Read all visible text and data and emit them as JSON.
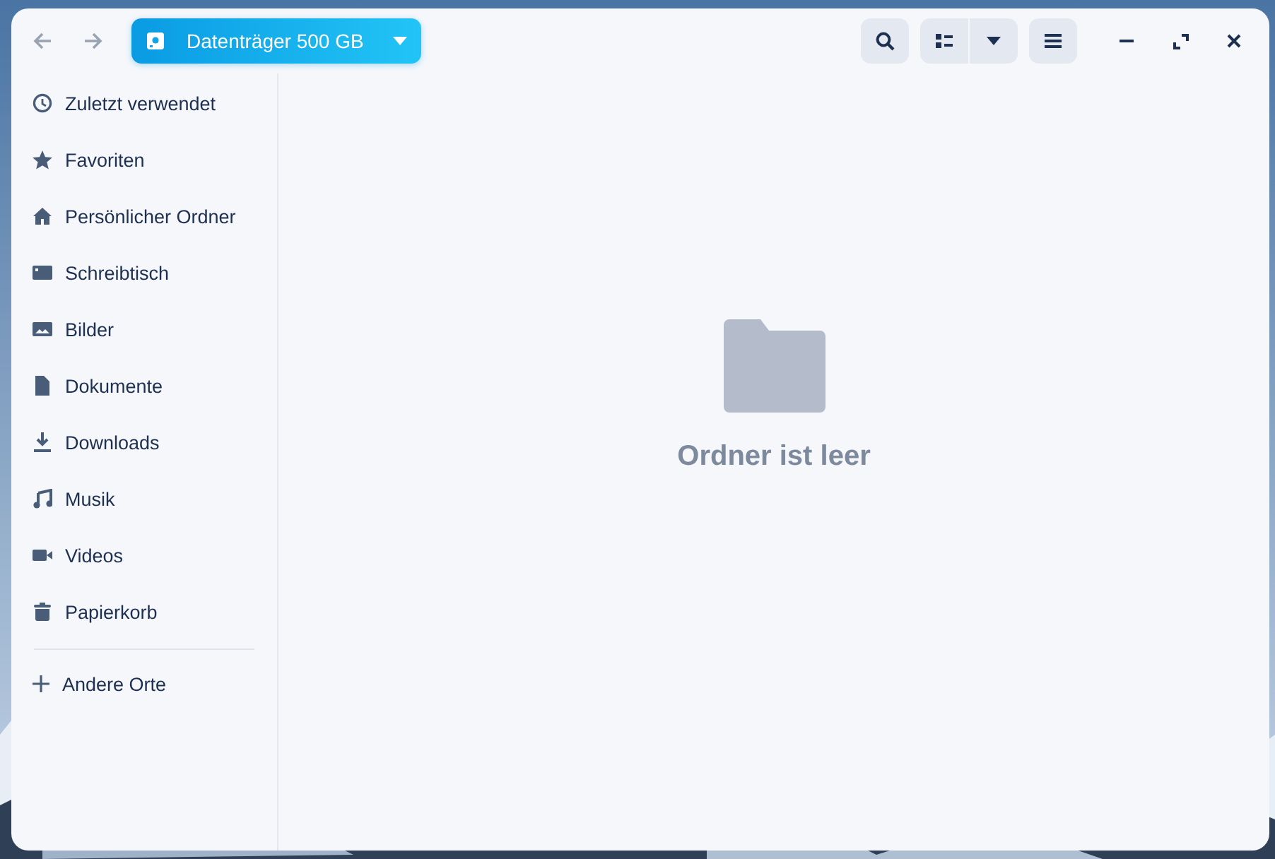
{
  "headerbar": {
    "location": {
      "label": "Datenträger 500 GB"
    }
  },
  "sidebar": {
    "items": [
      {
        "label": "Zuletzt verwendet"
      },
      {
        "label": "Favoriten"
      },
      {
        "label": "Persönlicher Ordner"
      },
      {
        "label": "Schreibtisch"
      },
      {
        "label": "Bilder"
      },
      {
        "label": "Dokumente"
      },
      {
        "label": "Downloads"
      },
      {
        "label": "Musik"
      },
      {
        "label": "Videos"
      },
      {
        "label": "Papierkorb"
      }
    ],
    "other": {
      "label": "Andere Orte"
    }
  },
  "content": {
    "empty_message": "Ordner ist leer"
  }
}
